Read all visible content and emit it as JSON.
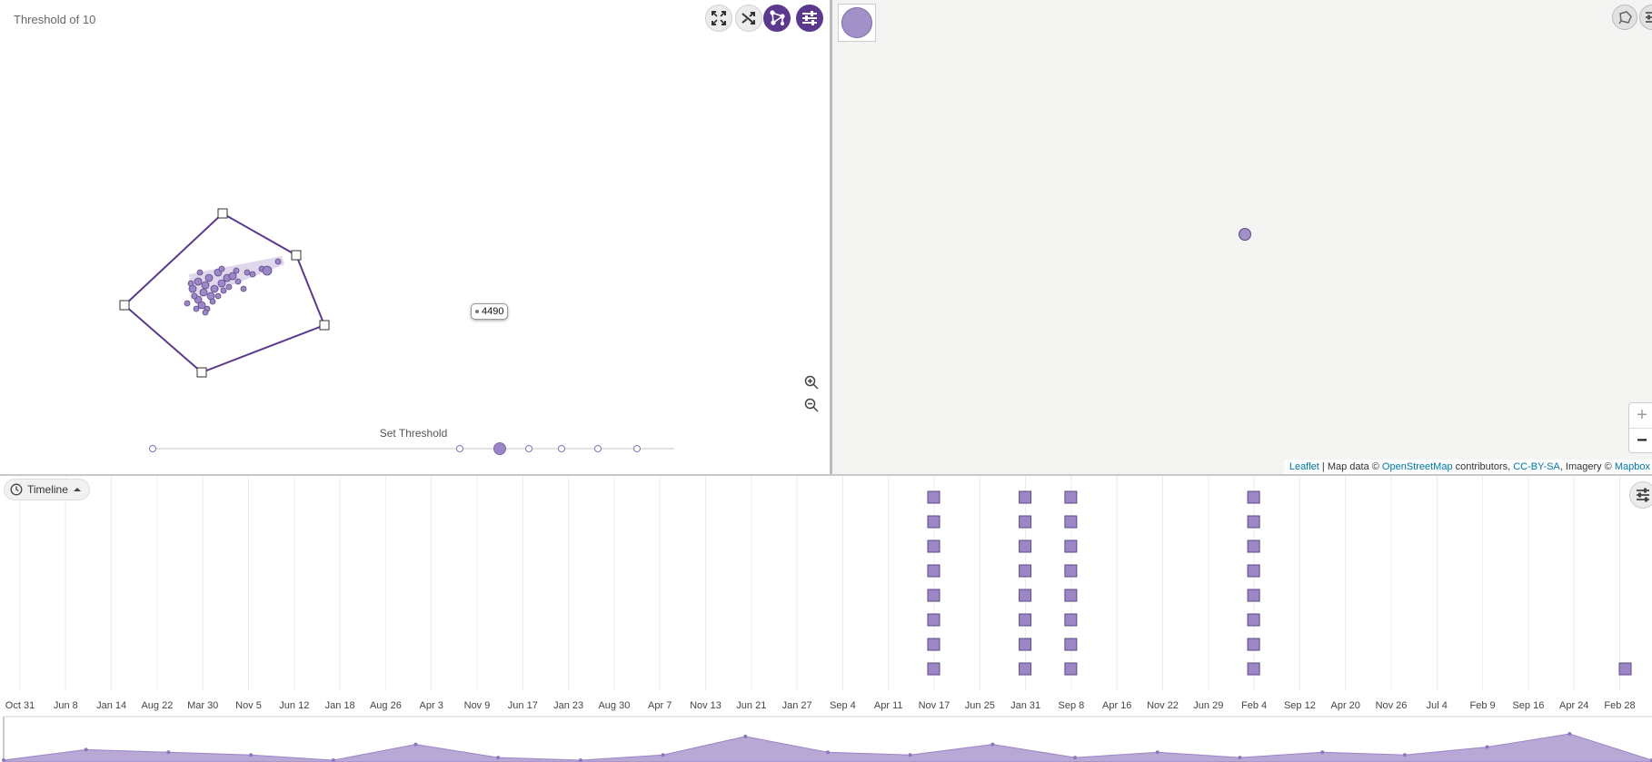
{
  "graph": {
    "title": "Threshold of 10",
    "tooltip_label": "4490",
    "threshold_label": "Set Threshold",
    "slider": {
      "stops": [
        0,
        0.588,
        0.722,
        0.784,
        0.853,
        0.929
      ],
      "selected_index": 1
    },
    "toolbar_icons": [
      "fullscreen-icon",
      "shuffle-icon",
      "network-icon",
      "settings-sliders-icon"
    ],
    "zoom_icons": [
      "zoom-in-icon",
      "zoom-out-icon"
    ],
    "accent_color": "#5b3a8e",
    "node_color": "#9c86c6"
  },
  "map": {
    "attribution": {
      "leaflet": "Leaflet",
      "sep": " | Map data © ",
      "osm": "OpenStreetMap",
      "contributors": " contributors, ",
      "license": "CC-BY-SA",
      "imagery": ", Imagery © ",
      "mapbox": "Mapbox"
    },
    "zoom_in": "+",
    "zoom_out": "−",
    "marker_color": "#a291c8",
    "controls": [
      "lasso-icon",
      "settings-sliders-icon"
    ]
  },
  "timeline": {
    "toggle_label": "Timeline",
    "dates": [
      "Oct 31",
      "Jun 8",
      "Jan 14",
      "Aug 22",
      "Mar 30",
      "Nov 5",
      "Jun 12",
      "Jan 18",
      "Aug 26",
      "Apr 3",
      "Nov 9",
      "Jun 17",
      "Jan 23",
      "Aug 30",
      "Apr 7",
      "Nov 13",
      "Jun 21",
      "Jan 27",
      "Sep 4",
      "Apr 11",
      "Nov 17",
      "Jun 25",
      "Jan 31",
      "Sep 8",
      "Apr 16",
      "Nov 22",
      "Jun 29",
      "Feb 4",
      "Sep 12",
      "Apr 20",
      "Nov 26",
      "Jul 4",
      "Feb 9",
      "Sep 16",
      "Apr 24",
      "Feb 28"
    ],
    "event_columns": [
      {
        "date": "Nov 17",
        "count": 8
      },
      {
        "date": "Jan 31",
        "count": 8
      },
      {
        "date": "Sep 8",
        "count": 8
      },
      {
        "date": "Feb 4",
        "count": 8
      },
      {
        "date": "Feb 28",
        "count": 1
      }
    ],
    "overview_values": [
      0,
      4,
      3,
      2,
      0,
      6,
      1,
      0,
      2,
      9,
      3,
      2,
      6,
      1,
      3,
      1,
      3,
      2,
      5,
      10,
      0
    ],
    "event_color": "#9c86c6"
  }
}
